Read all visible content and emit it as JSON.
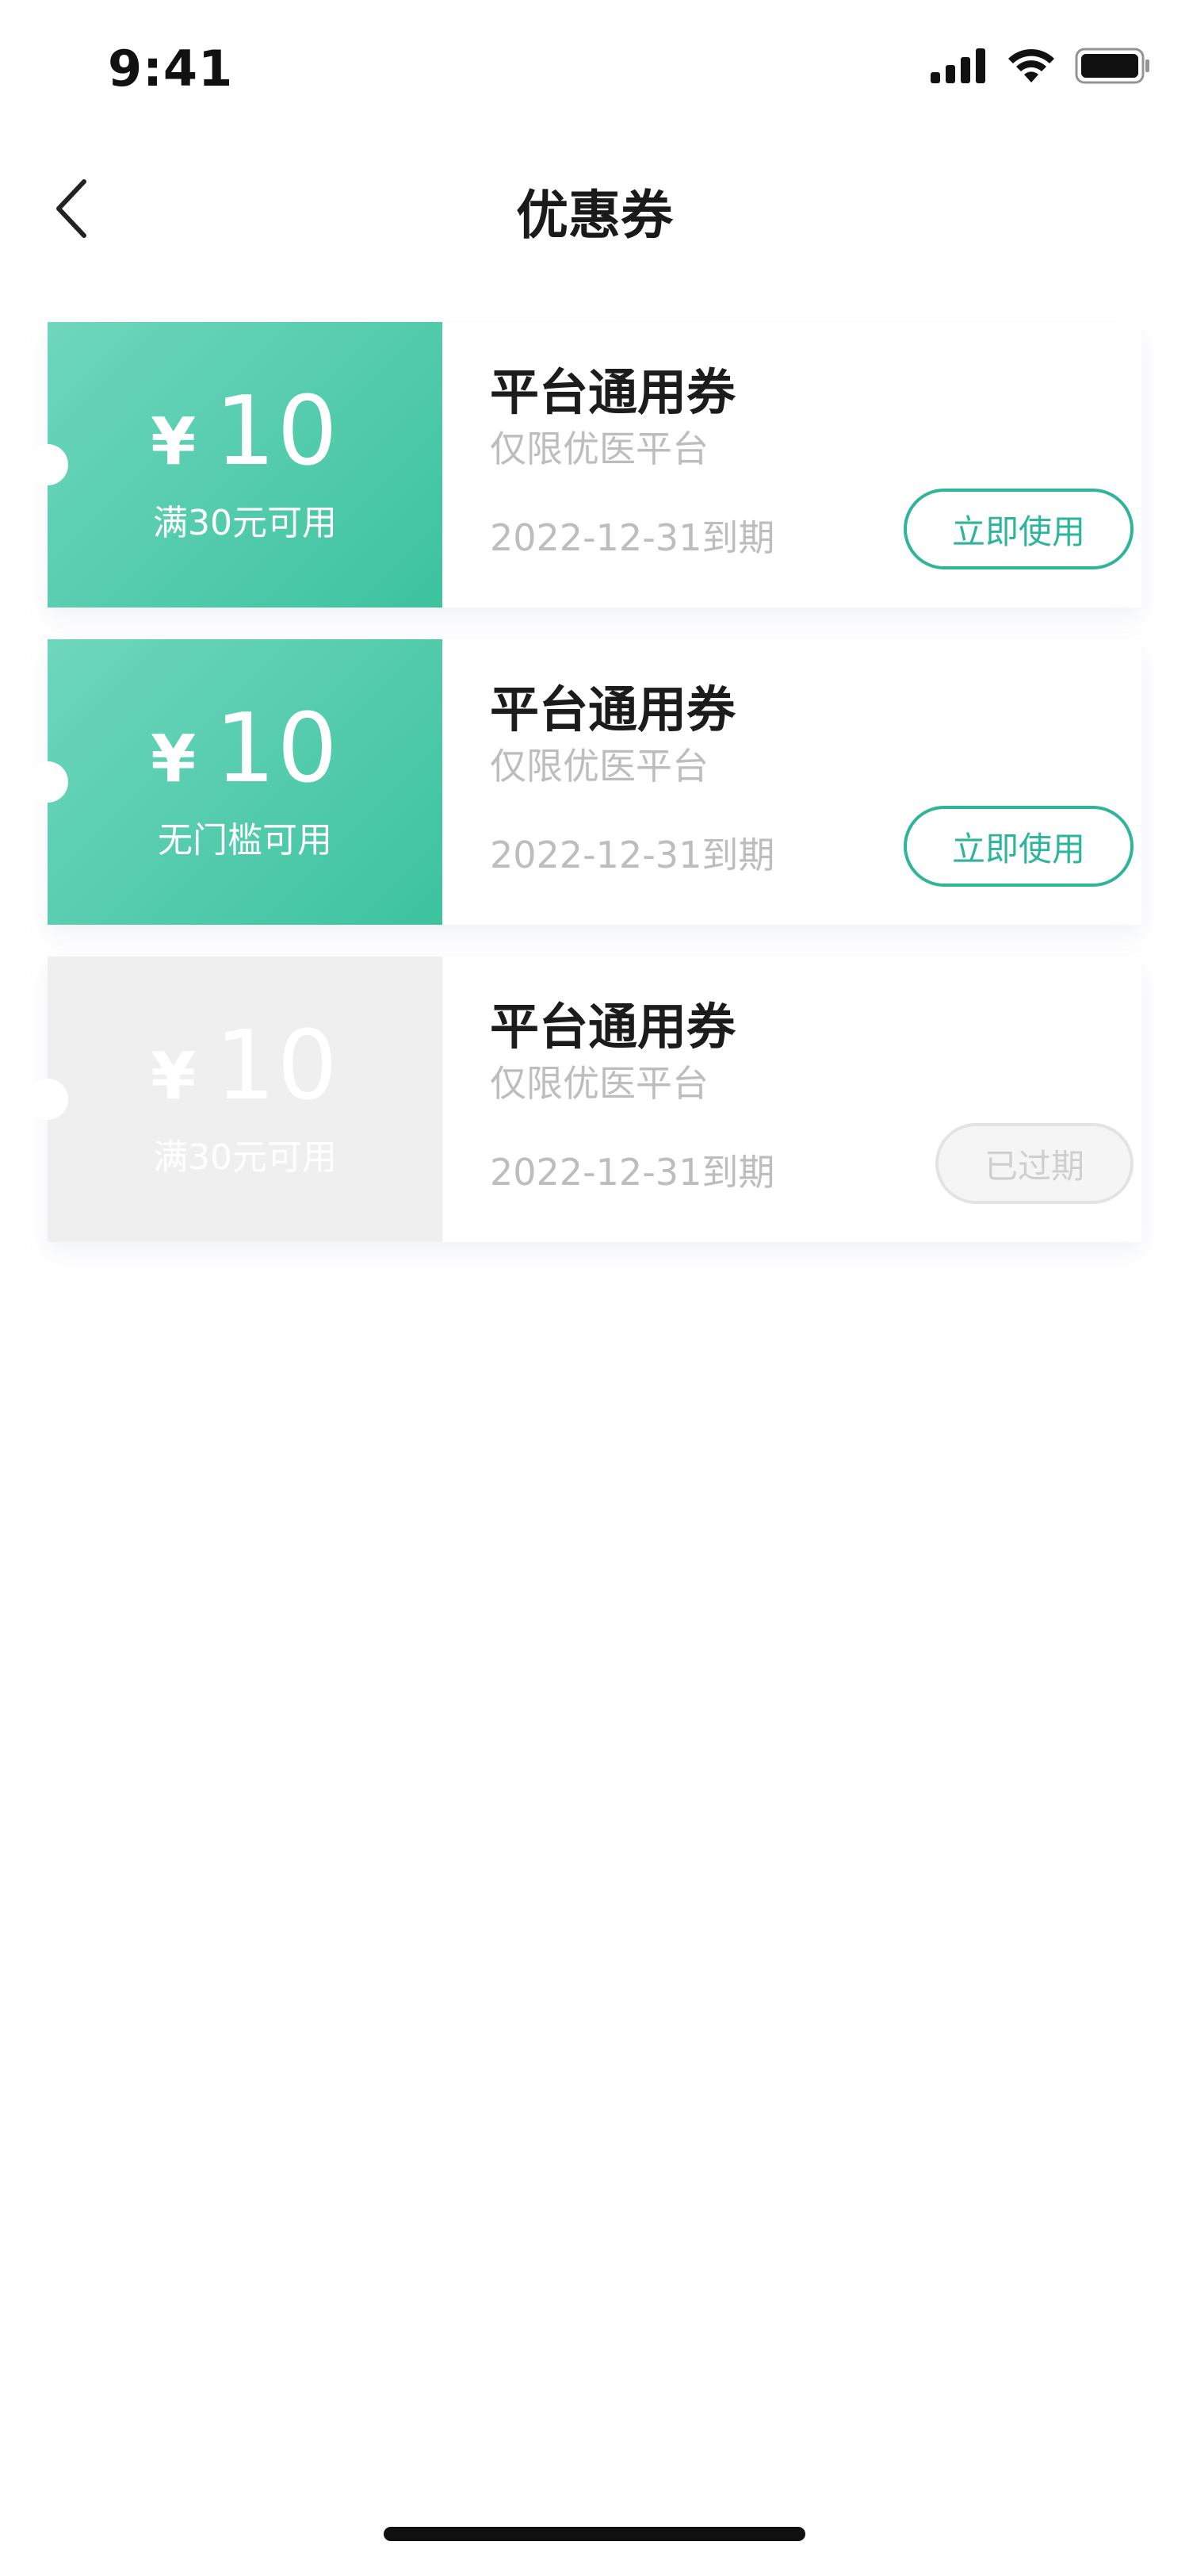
{
  "status_bar": {
    "time": "9:41",
    "icons": [
      "cellular-signal-icon",
      "wifi-icon",
      "battery-icon"
    ]
  },
  "nav": {
    "back_icon": "chevron-left-icon",
    "title": "优惠券"
  },
  "coupons": [
    {
      "currency": "¥",
      "amount": "10",
      "condition": "满30元可用",
      "title": "平台通用券",
      "scope": "仅限优医平台",
      "expiry": "2022-12-31到期",
      "action_label": "立即使用",
      "status": "active"
    },
    {
      "currency": "¥",
      "amount": "10",
      "condition": "无门槛可用",
      "title": "平台通用券",
      "scope": "仅限优医平台",
      "expiry": "2022-12-31到期",
      "action_label": "立即使用",
      "status": "active"
    },
    {
      "currency": "¥",
      "amount": "10",
      "condition": "满30元可用",
      "title": "平台通用券",
      "scope": "仅限优医平台",
      "expiry": "2022-12-31到期",
      "action_label": "已过期",
      "status": "expired"
    }
  ],
  "colors": {
    "accent": "#2db59a",
    "coupon_gradient_start": "#6ed6bd",
    "coupon_gradient_end": "#3dc39e",
    "expired_gray": "#efefef",
    "muted_text": "#bdbdbd"
  }
}
